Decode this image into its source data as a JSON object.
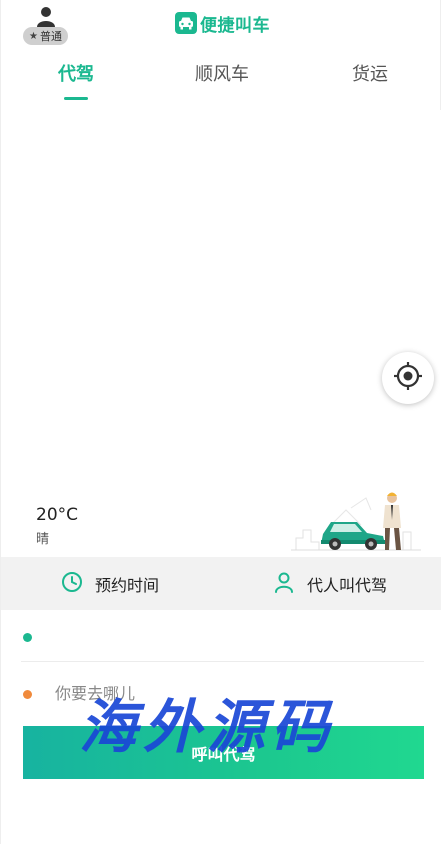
{
  "header": {
    "member_badge": "普通",
    "brand_title": "便捷叫车"
  },
  "tabs": [
    {
      "label": "代驾",
      "active": true
    },
    {
      "label": "顺风车",
      "active": false
    },
    {
      "label": "货运",
      "active": false
    }
  ],
  "weather": {
    "temperature": "20°C",
    "condition": "晴"
  },
  "options": {
    "schedule_label": "预约时间",
    "proxy_label": "代人叫代驾"
  },
  "form": {
    "pickup_value": "",
    "destination_placeholder": "你要去哪儿",
    "call_button_label": "呼叫代驾"
  },
  "watermark": "海外源码",
  "colors": {
    "accent": "#1bb890",
    "pickup_dot": "#1bb890",
    "destination_dot": "#f08a3c",
    "options_bg": "#f2f2f2",
    "watermark": "#1a47d6"
  },
  "icons": {
    "avatar": "user-icon",
    "star": "star-icon",
    "brand": "car-icon",
    "locate": "locate-icon",
    "schedule": "clock-icon",
    "proxy": "person-icon"
  }
}
